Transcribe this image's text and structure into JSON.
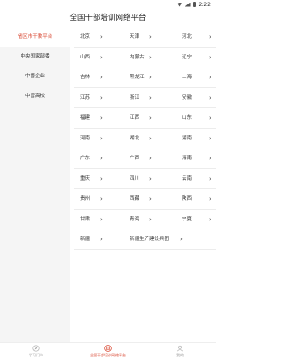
{
  "status": {
    "time": "2:22"
  },
  "header": {
    "title": "全国干部培训网络平台"
  },
  "sidebar": {
    "items": [
      {
        "label": "省区市干教平台"
      },
      {
        "label": "中央国家部委"
      },
      {
        "label": "中管企业"
      },
      {
        "label": "中管高校"
      }
    ]
  },
  "grid": {
    "rows": [
      [
        "北京",
        "天津",
        "河北"
      ],
      [
        "山西",
        "内蒙古",
        "辽宁"
      ],
      [
        "吉林",
        "黑龙江",
        "上海"
      ],
      [
        "江苏",
        "浙江",
        "安徽"
      ],
      [
        "福建",
        "江西",
        "山东"
      ],
      [
        "河南",
        "湖北",
        "湖南"
      ],
      [
        "广东",
        "广西",
        "海南"
      ],
      [
        "重庆",
        "四川",
        "云南"
      ],
      [
        "贵州",
        "西藏",
        "陕西"
      ],
      [
        "甘肃",
        "青海",
        "宁夏"
      ],
      [
        "新疆",
        "新疆生产建设兵团"
      ]
    ]
  },
  "bottom_nav": {
    "items": [
      {
        "label": "学习门户",
        "icon": "compass-icon"
      },
      {
        "label": "全国干部培训网络平台",
        "icon": "platform-icon"
      },
      {
        "label": "我的",
        "icon": "user-icon"
      }
    ]
  },
  "colors": {
    "accent": "#d8442e"
  }
}
